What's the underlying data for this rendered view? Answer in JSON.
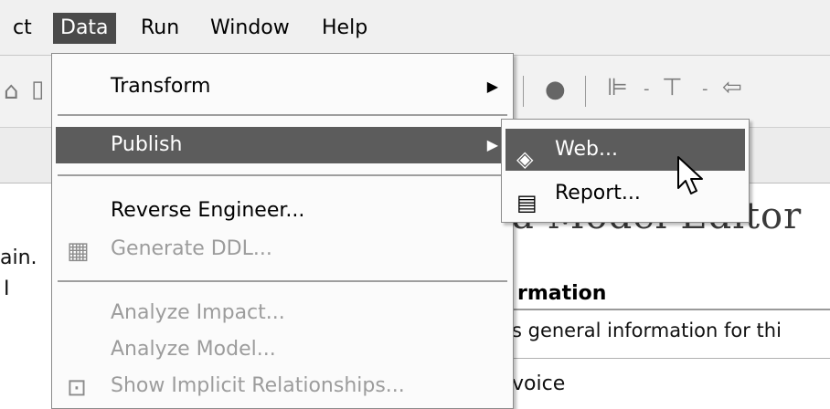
{
  "menubar": {
    "items": [
      {
        "label": "ct"
      },
      {
        "label": "Data"
      },
      {
        "label": "Run"
      },
      {
        "label": "Window"
      },
      {
        "label": "Help"
      }
    ]
  },
  "data_menu": {
    "items": [
      {
        "label": "Transform",
        "has_submenu": true,
        "state": "normal"
      },
      {
        "label": "Publish",
        "has_submenu": true,
        "state": "selected"
      },
      {
        "label": "Reverse Engineer...",
        "state": "normal"
      },
      {
        "label": "Generate DDL...",
        "state": "disabled",
        "icon": "ddl-icon"
      },
      {
        "label": "Analyze Impact...",
        "state": "disabled"
      },
      {
        "label": "Analyze Model...",
        "state": "disabled"
      },
      {
        "label": "Show Implicit Relationships...",
        "state": "disabled",
        "icon": "relationship-icon"
      }
    ]
  },
  "publish_submenu": {
    "items": [
      {
        "label": "Web...",
        "icon": "web-publish-icon",
        "state": "selected"
      },
      {
        "label": "Report...",
        "icon": "report-icon",
        "state": "normal"
      }
    ]
  },
  "background": {
    "editor_title": "a Model Editor",
    "left_text_1": "ain.",
    "left_text_2": "I",
    "section_header": "rmation",
    "section_desc": "s general information for thi",
    "invoice_text": "voice"
  },
  "colors": {
    "menu_highlight": "#5c5c5c",
    "disabled_text": "#9c9c9c"
  }
}
